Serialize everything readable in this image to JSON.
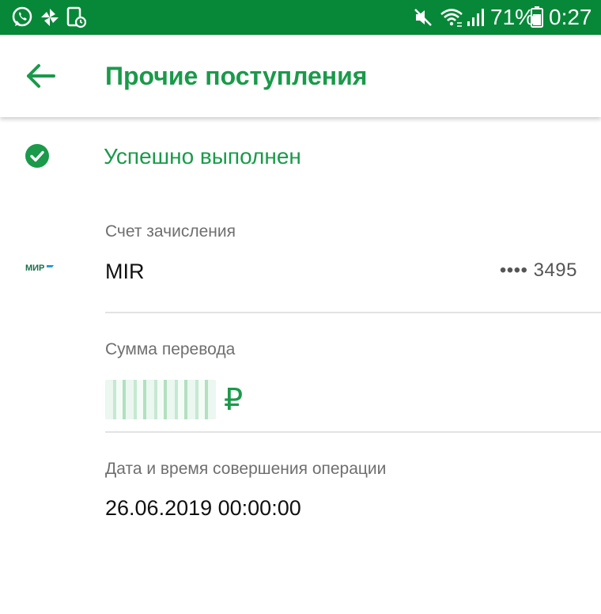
{
  "status_bar": {
    "battery_percent": "71%",
    "time": "0:27",
    "icons_left": [
      "whatsapp-icon",
      "pinwheel-icon",
      "doc-clock-icon"
    ],
    "icons_right": [
      "mute-icon",
      "wifi-icon",
      "signal-icon",
      "battery-icon"
    ]
  },
  "app_bar": {
    "title": "Прочие поступления"
  },
  "operation": {
    "status": "Успешно выполнен",
    "account_label": "Счет зачисления",
    "card_name": "MIR",
    "card_number_masked": "•••• 3495",
    "amount_label": "Сумма перевода",
    "currency": "₽",
    "datetime_label": "Дата и время совершения операции",
    "datetime_value": "26.06.2019 00:00:00"
  },
  "colors": {
    "status_bar": "#078838",
    "accent": "#1a9a4a",
    "label": "#6f6f6f"
  }
}
